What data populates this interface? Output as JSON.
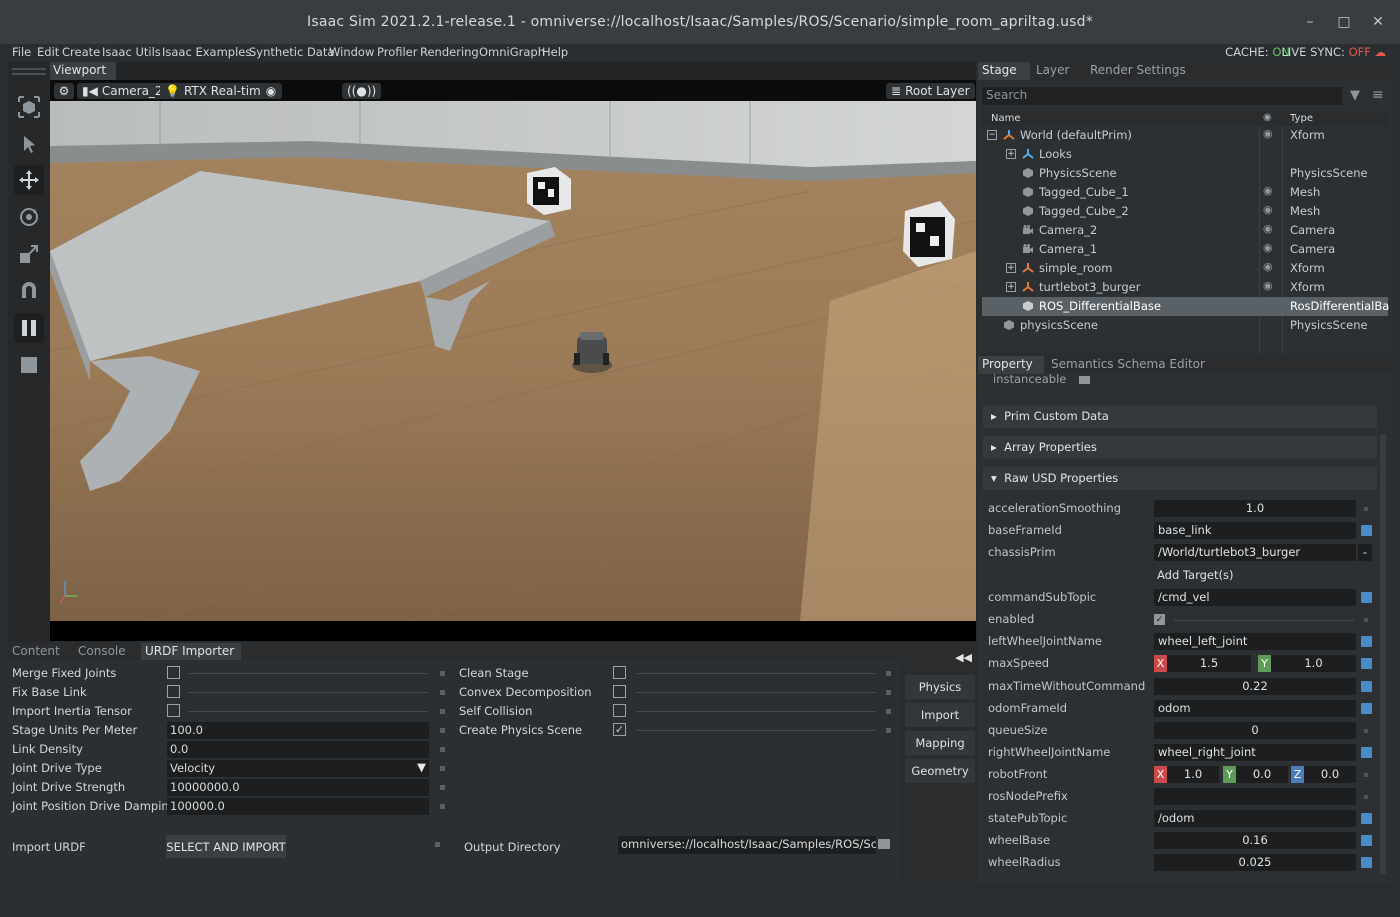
{
  "window": {
    "title": "Isaac Sim 2021.2.1-release.1 - omniverse://localhost/Isaac/Samples/ROS/Scenario/simple_room_apriltag.usd*",
    "minimize": "–",
    "maximize": "□",
    "close": "✕"
  },
  "menu": {
    "items": [
      "File",
      "Edit",
      "Create",
      "Isaac Utils",
      "Isaac Examples",
      "Synthetic Data",
      "Window",
      "Profiler",
      "Rendering",
      "OmniGraph",
      "Help"
    ],
    "cache_label": "CACHE:",
    "cache_value": "ON",
    "sync_label": "LIVE SYNC:",
    "sync_value": "OFF"
  },
  "viewport": {
    "tab": "Viewport",
    "camera": "Camera_2",
    "renderer": "RTX Real-time",
    "layer": "Root Layer",
    "stream_icon": "((●))"
  },
  "bottom_tabs": [
    "Content",
    "Console",
    "URDF Importer"
  ],
  "urdf": {
    "left": [
      {
        "label": "Merge Fixed Joints",
        "kind": "checkbox",
        "checked": false
      },
      {
        "label": "Fix Base Link",
        "kind": "checkbox",
        "checked": false
      },
      {
        "label": "Import Inertia Tensor",
        "kind": "checkbox",
        "checked": false
      },
      {
        "label": "Stage Units Per Meter",
        "kind": "field",
        "value": "100.0"
      },
      {
        "label": "Link Density",
        "kind": "field",
        "value": "0.0"
      },
      {
        "label": "Joint Drive Type",
        "kind": "select",
        "value": "Velocity"
      },
      {
        "label": "Joint Drive Strength",
        "kind": "field",
        "value": "10000000.0"
      },
      {
        "label": "Joint Position Drive Damping",
        "kind": "field",
        "value": "100000.0"
      }
    ],
    "right": [
      {
        "label": "Clean Stage",
        "checked": false
      },
      {
        "label": "Convex Decomposition",
        "checked": false
      },
      {
        "label": "Self Collision",
        "checked": false
      },
      {
        "label": "Create Physics Scene",
        "checked": true
      }
    ],
    "import_label": "Import URDF",
    "import_button": "SELECT AND IMPORT",
    "output_label": "Output Directory",
    "output_value": "omniverse://localhost/Isaac/Samples/ROS/Scen"
  },
  "side_buttons": [
    "Physics",
    "Import",
    "Mapping",
    "Geometry"
  ],
  "stage": {
    "tabs": [
      "Stage",
      "Layer",
      "Render Settings"
    ],
    "search_placeholder": "Search",
    "col_name": "Name",
    "col_type": "Type",
    "rows": [
      {
        "name": "World (defaultPrim)",
        "type": "Xform",
        "indent": 0,
        "icon": "xform-icon",
        "expander": "−",
        "eye": true
      },
      {
        "name": "Looks",
        "type": "",
        "indent": 1,
        "icon": "xform-icon",
        "expander": "+",
        "eye": false
      },
      {
        "name": "PhysicsScene",
        "type": "PhysicsScene",
        "indent": 2,
        "icon": "prim-icon",
        "expander": "",
        "eye": false
      },
      {
        "name": "Tagged_Cube_1",
        "type": "Mesh",
        "indent": 2,
        "icon": "prim-icon",
        "expander": "",
        "eye": true
      },
      {
        "name": "Tagged_Cube_2",
        "type": "Mesh",
        "indent": 2,
        "icon": "prim-icon",
        "expander": "",
        "eye": true
      },
      {
        "name": "Camera_2",
        "type": "Camera",
        "indent": 2,
        "icon": "camera-icon",
        "expander": "",
        "eye": true
      },
      {
        "name": "Camera_1",
        "type": "Camera",
        "indent": 2,
        "icon": "camera-icon",
        "expander": "",
        "eye": true
      },
      {
        "name": "simple_room",
        "type": "Xform",
        "indent": 1,
        "icon": "ref-xform-icon",
        "expander": "+",
        "eye": true
      },
      {
        "name": "turtlebot3_burger",
        "type": "Xform",
        "indent": 1,
        "icon": "ref-xform-icon",
        "expander": "+",
        "eye": true
      },
      {
        "name": "ROS_DifferentialBase",
        "type": "RosDifferentialBa",
        "indent": 2,
        "icon": "prim-icon",
        "expander": "",
        "eye": false,
        "selected": true
      },
      {
        "name": "physicsScene",
        "type": "PhysicsScene",
        "indent": 0,
        "icon": "prim-icon",
        "expander": "",
        "eye": false
      }
    ]
  },
  "property": {
    "tabs": [
      "Property",
      "Semantics Schema Editor"
    ],
    "cut_label": "instanceable",
    "sections": [
      "Prim Custom Data",
      "Array Properties",
      "Raw USD Properties"
    ],
    "add_target": "Add Target(s)",
    "rows": [
      {
        "label": "accelerationSmoothing",
        "kind": "num",
        "value": "1.0",
        "marker": "dot"
      },
      {
        "label": "baseFrameId",
        "kind": "text",
        "value": "base_link",
        "marker": "blue"
      },
      {
        "label": "chassisPrim",
        "kind": "text",
        "value": "/World/turtlebot3_burger",
        "marker": "dash"
      },
      {
        "label": "commandSubTopic",
        "kind": "text",
        "value": "/cmd_vel",
        "marker": "blue"
      },
      {
        "label": "enabled",
        "kind": "check",
        "value": "✓",
        "marker": "dot"
      },
      {
        "label": "leftWheelJointName",
        "kind": "text",
        "value": "wheel_left_joint",
        "marker": "blue"
      },
      {
        "label": "maxSpeed",
        "kind": "vec2",
        "values": [
          "1.5",
          "1.0"
        ],
        "marker": "blue"
      },
      {
        "label": "maxTimeWithoutCommand",
        "kind": "num",
        "value": "0.22",
        "marker": "blue"
      },
      {
        "label": "odomFrameId",
        "kind": "text",
        "value": "odom",
        "marker": "blue"
      },
      {
        "label": "queueSize",
        "kind": "num",
        "value": "0",
        "marker": "dot"
      },
      {
        "label": "rightWheelJointName",
        "kind": "text",
        "value": "wheel_right_joint",
        "marker": "blue"
      },
      {
        "label": "robotFront",
        "kind": "vec3",
        "values": [
          "1.0",
          "0.0",
          "0.0"
        ],
        "marker": "dot"
      },
      {
        "label": "rosNodePrefix",
        "kind": "text",
        "value": "",
        "marker": "dot"
      },
      {
        "label": "statePubTopic",
        "kind": "text",
        "value": "/odom",
        "marker": "blue"
      },
      {
        "label": "wheelBase",
        "kind": "num",
        "value": "0.16",
        "marker": "blue"
      },
      {
        "label": "wheelRadius",
        "kind": "num",
        "value": "0.025",
        "marker": "blue"
      }
    ],
    "axis_x": "X",
    "axis_y": "Y",
    "axis_z": "Z",
    "collapse_icon": "◀◀"
  },
  "colors": {
    "accent_blue": "#4a8bc8",
    "cache_on": "#62c26a",
    "sync_off": "#e4574e",
    "selection": "#5a6166"
  }
}
